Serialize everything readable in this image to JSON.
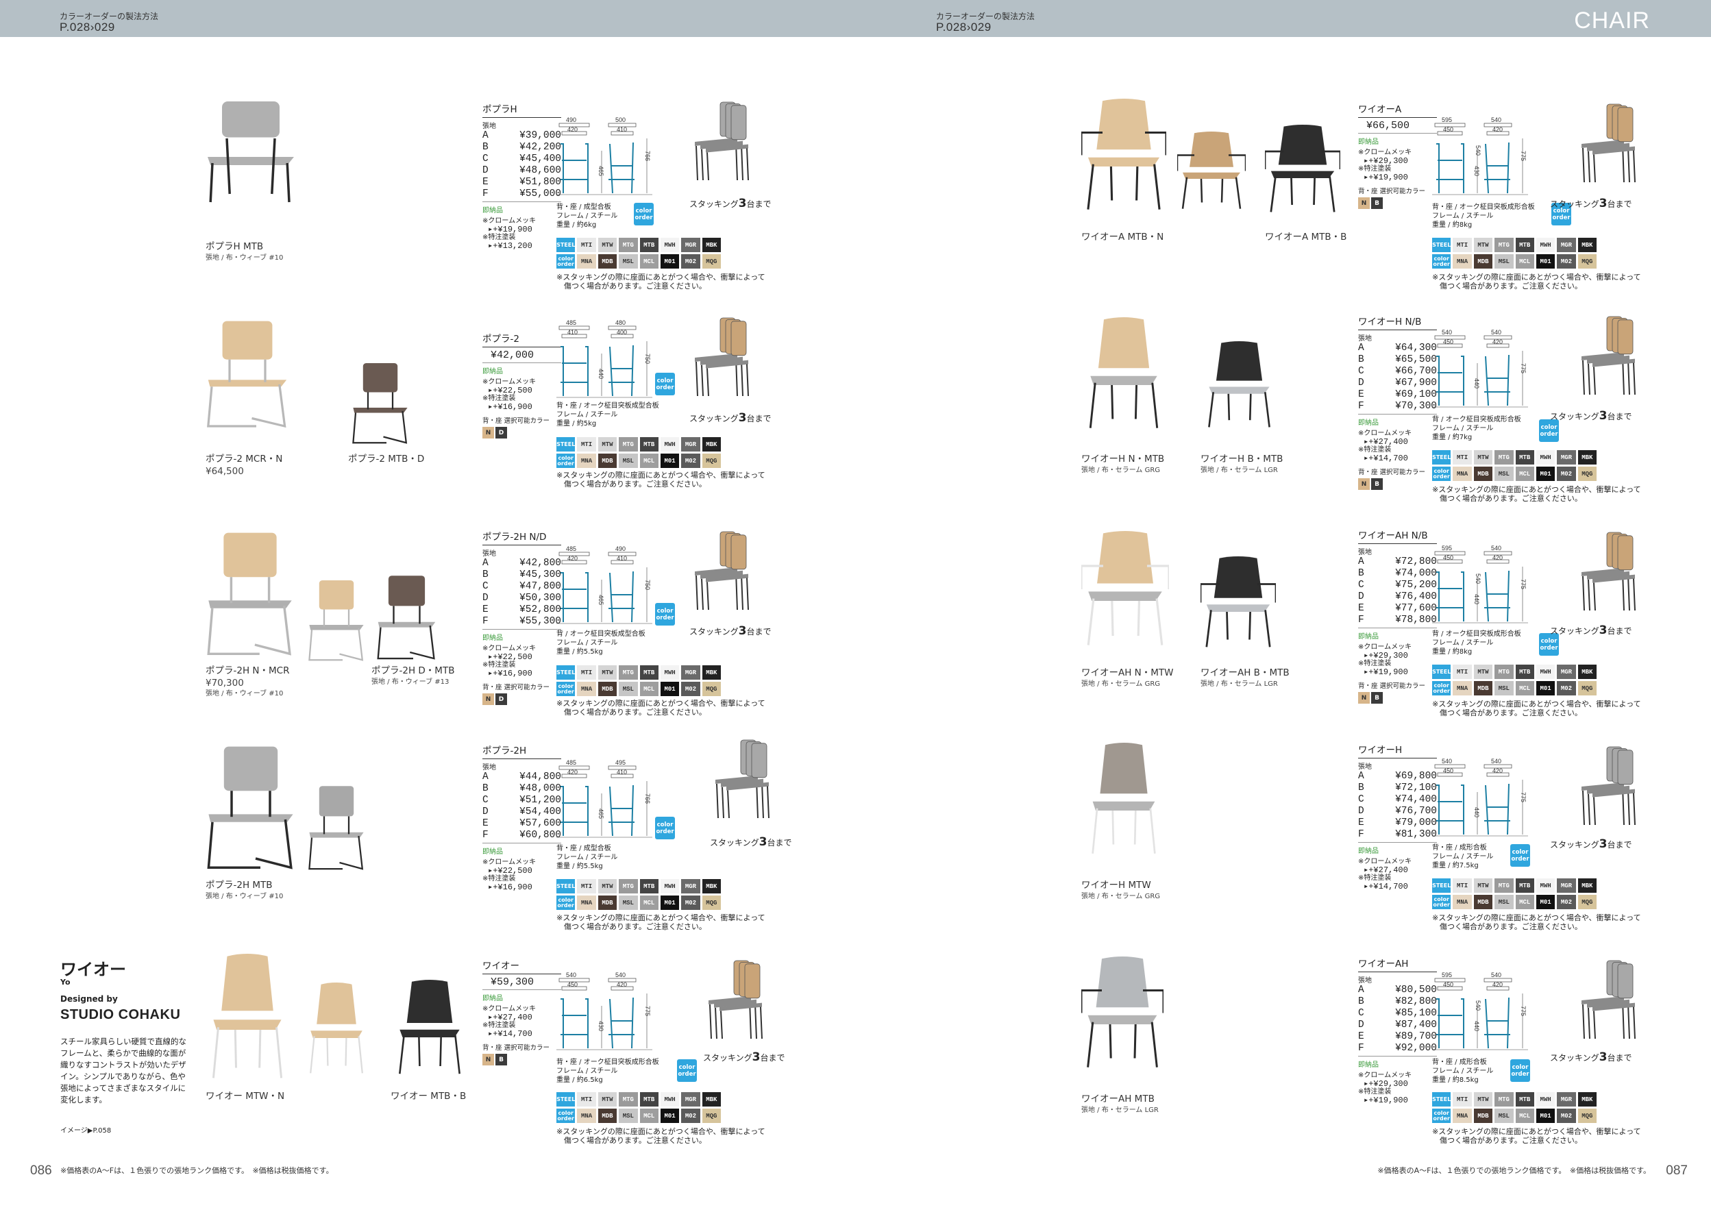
{
  "header": {
    "left_caption": "カラーオーダーの製法方法",
    "left_pages": "P.028›029",
    "right_caption": "カラーオーダーの製法方法",
    "right_pages": "P.028›029",
    "category": "CHAIR"
  },
  "footer": {
    "left_page": "086",
    "right_page": "087",
    "left_note": "※価格表のA～Fは、１色張りでの張地ランク価格です。　※価格は税抜価格です。",
    "right_note": "※価格表のA～Fは、１色張りでの張地ランク価格です。　※価格は税抜価格です。"
  },
  "common": {
    "color_order": "color order",
    "stock_label": "即納品",
    "table_head": "張地",
    "chrome_label": "※クロームメッキ",
    "special_label": "※特注塗装",
    "color_select": "背・座 選択可能カラー",
    "steel_label": "STEEL",
    "color_order_label": "color order",
    "caution1": "※スタッキングの際に座面にあとがつく場合や、衝撃によって",
    "caution2": "　傷つく場合があります。ご注意ください。",
    "stack_prefix": "スタッキング",
    "stack_num": "3",
    "stack_suffix": "台まで",
    "n_label": "N",
    "b_label": "B"
  },
  "grid": {
    "row1": [
      "MTI",
      "MTW",
      "MTG",
      "MTB",
      "MWH",
      "MGR",
      "MBK"
    ],
    "row2": [
      "MNA",
      "MDB",
      "MSL",
      "MCL",
      "M01",
      "M02",
      "MQG"
    ]
  },
  "series": {
    "title": "ワイオー",
    "subtitle": "Yo",
    "designed_by": "Designed by",
    "studio": "STUDIO COHAKU",
    "description": "スチール家具らしい硬質で直線的なフレームと、柔らかで曲線的な面が織りなすコントラストが効いたデザイン。シンプルでありながら、色や張地によってさまざまなスタイルに変化します。",
    "image_ref": "イメージ▶P.058"
  },
  "models": [
    {
      "name": "ポプラH",
      "label1": "ポプラH MTB",
      "label1_sub": "張地 / 布・ウィーブ #10",
      "prices": [
        [
          "A",
          "¥39,000"
        ],
        [
          "B",
          "¥42,200"
        ],
        [
          "C",
          "¥45,400"
        ],
        [
          "D",
          "¥48,600"
        ],
        [
          "E",
          "¥51,800"
        ],
        [
          "F",
          "¥55,000"
        ]
      ],
      "chrome": "+¥19,900",
      "special": "+¥13,200",
      "material1": "背・座 / 成型合板",
      "material2": "フレーム / スチール",
      "material3": "重量 / 約6kg",
      "dims": {
        "w1": "490",
        "w2": "420",
        "d1": "500",
        "d2": "410",
        "h1": "465",
        "h2": "766"
      }
    },
    {
      "name": "ポプラ-2",
      "single": "¥42,000",
      "label1": "ポプラ-2 MCR・N",
      "label1_price": "¥64,500",
      "label2": "ポプラ-2 MTB・D",
      "chrome": "+¥22,500",
      "special": "+¥16,900",
      "material1": "背・座 / オーク柾目突板成型合板",
      "material2": "フレーム / スチール",
      "material3": "重量 / 約5kg",
      "dims": {
        "w1": "485",
        "w2": "410",
        "d1": "480",
        "d2": "400",
        "h1": "440",
        "h2": "750"
      }
    },
    {
      "name": "ポプラ-2H N/D",
      "label1": "ポプラ-2H N・MCR",
      "label1_price": "¥70,300",
      "label1_sub": "張地 / 布・ウィーブ #10",
      "label2": "ポプラ-2H D・MTB",
      "label2_sub": "張地 / 布・ウィーブ #13",
      "prices": [
        [
          "A",
          "¥42,800"
        ],
        [
          "B",
          "¥45,300"
        ],
        [
          "C",
          "¥47,800"
        ],
        [
          "D",
          "¥50,300"
        ],
        [
          "E",
          "¥52,800"
        ],
        [
          "F",
          "¥55,300"
        ]
      ],
      "chrome": "+¥22,500",
      "special": "+¥16,900",
      "material1": "背 / オーク柾目突板成型合板",
      "material2": "フレーム / スチール",
      "material3": "重量 / 約5.5kg",
      "dims": {
        "w1": "485",
        "w2": "420",
        "d1": "490",
        "d2": "410",
        "h1": "465",
        "h2": "750"
      }
    },
    {
      "name": "ポプラ-2H",
      "label1": "ポプラ-2H MTB",
      "label1_sub": "張地 / 布・ウィーブ #10",
      "prices": [
        [
          "A",
          "¥44,800"
        ],
        [
          "B",
          "¥48,000"
        ],
        [
          "C",
          "¥51,200"
        ],
        [
          "D",
          "¥54,400"
        ],
        [
          "E",
          "¥57,600"
        ],
        [
          "F",
          "¥60,800"
        ]
      ],
      "chrome": "+¥22,500",
      "special": "+¥16,900",
      "material1": "背・座 / 成型合板",
      "material2": "フレーム / スチール",
      "material3": "重量 / 約5.5kg",
      "dims": {
        "w1": "485",
        "w2": "420",
        "d1": "495",
        "d2": "410",
        "h1": "465",
        "h2": "766"
      }
    },
    {
      "name": "ワイオー",
      "single": "¥59,300",
      "label1": "ワイオー MTW・N",
      "label2": "ワイオー MTB・B",
      "chrome": "+¥27,400",
      "special": "+¥14,700",
      "material1": "背・座 / オーク柾目突板成形合板",
      "material2": "フレーム / スチール",
      "material3": "重量 / 約6.5kg",
      "dims": {
        "w1": "540",
        "w2": "450",
        "d1": "540",
        "d2": "420",
        "h1": "430",
        "h2": "775"
      }
    },
    {
      "name": "ワイオーA",
      "single": "¥66,500",
      "label1": "ワイオーA MTB・N",
      "label2": "ワイオーA MTB・B",
      "chrome": "+¥29,300",
      "special": "+¥19,900",
      "material1": "背・座 / オーク柾目突板成形合板",
      "material2": "フレーム / スチール",
      "material3": "重量 / 約8kg",
      "dims": {
        "w1": "595",
        "w2": "450",
        "d1": "540",
        "d2": "420",
        "h1": "430",
        "h2": "775",
        "h3": "540"
      }
    },
    {
      "name": "ワイオーH N/B",
      "label1": "ワイオーH N・MTB",
      "label1_sub": "張地 / 布・セラーム GRG",
      "label2": "ワイオーH B・MTB",
      "label2_sub": "張地 / 布・セラーム LGR",
      "prices": [
        [
          "A",
          "¥64,300"
        ],
        [
          "B",
          "¥65,500"
        ],
        [
          "C",
          "¥66,700"
        ],
        [
          "D",
          "¥67,900"
        ],
        [
          "E",
          "¥69,100"
        ],
        [
          "F",
          "¥70,300"
        ]
      ],
      "chrome": "+¥27,400",
      "special": "+¥14,700",
      "material1": "背 / オーク柾目突板成形合板",
      "material2": "フレーム / スチール",
      "material3": "重量 / 約7kg",
      "dims": {
        "w1": "540",
        "w2": "450",
        "d1": "540",
        "d2": "420",
        "h1": "440",
        "h2": "775"
      }
    },
    {
      "name": "ワイオーAH N/B",
      "label1": "ワイオーAH N・MTW",
      "label1_sub": "張地 / 布・セラーム GRG",
      "label2": "ワイオーAH B・MTB",
      "label2_sub": "張地 / 布・セラーム LGR",
      "prices": [
        [
          "A",
          "¥72,800"
        ],
        [
          "B",
          "¥74,000"
        ],
        [
          "C",
          "¥75,200"
        ],
        [
          "D",
          "¥76,400"
        ],
        [
          "E",
          "¥77,600"
        ],
        [
          "F",
          "¥78,800"
        ]
      ],
      "chrome": "+¥29,300",
      "special": "+¥19,900",
      "material1": "背 / オーク柾目突板成形合板",
      "material2": "フレーム / スチール",
      "material3": "重量 / 約8kg",
      "dims": {
        "w1": "595",
        "w2": "450",
        "d1": "540",
        "d2": "420",
        "h1": "440",
        "h2": "775",
        "h3": "540"
      }
    },
    {
      "name": "ワイオーH",
      "label1": "ワイオーH MTW",
      "label1_sub": "張地 / 布・セラーム GRG",
      "prices": [
        [
          "A",
          "¥69,800"
        ],
        [
          "B",
          "¥72,100"
        ],
        [
          "C",
          "¥74,400"
        ],
        [
          "D",
          "¥76,700"
        ],
        [
          "E",
          "¥79,000"
        ],
        [
          "F",
          "¥81,300"
        ]
      ],
      "chrome": "+¥27,400",
      "special": "+¥14,700",
      "material1": "背・座 / 成形合板",
      "material2": "フレーム / スチール",
      "material3": "重量 / 約7.5kg",
      "dims": {
        "w1": "540",
        "w2": "450",
        "d1": "540",
        "d2": "420",
        "h1": "440",
        "h2": "775"
      }
    },
    {
      "name": "ワイオーAH",
      "label1": "ワイオーAH MTB",
      "label1_sub": "張地 / 布・セラーム LGR",
      "prices": [
        [
          "A",
          "¥80,500"
        ],
        [
          "B",
          "¥82,800"
        ],
        [
          "C",
          "¥85,100"
        ],
        [
          "D",
          "¥87,400"
        ],
        [
          "E",
          "¥89,700"
        ],
        [
          "F",
          "¥92,000"
        ]
      ],
      "chrome": "+¥29,300",
      "special": "+¥19,900",
      "material1": "背・座 / 成形合板",
      "material2": "フレーム / スチール",
      "material3": "重量 / 約8.5kg",
      "dims": {
        "w1": "595",
        "w2": "450",
        "d1": "540",
        "d2": "420",
        "h1": "440",
        "h2": "775",
        "h3": "540"
      }
    }
  ],
  "swatch_colors": {
    "MTI": "#e9e9e9",
    "MTW": "#d5d5d5",
    "MTG": "#9a9a9a",
    "MTB": "#444444",
    "MWH": "#f3f3f3",
    "MGR": "#6a6a6a",
    "MBK": "#222222",
    "MNA": "#e5d5c0",
    "MDB": "#4a3a32",
    "MSL": "#c6c6c6",
    "MCL": "#9e9e9e",
    "M01": "#111111",
    "M02": "#5a5a5a",
    "MQG": "#d6c49b"
  }
}
